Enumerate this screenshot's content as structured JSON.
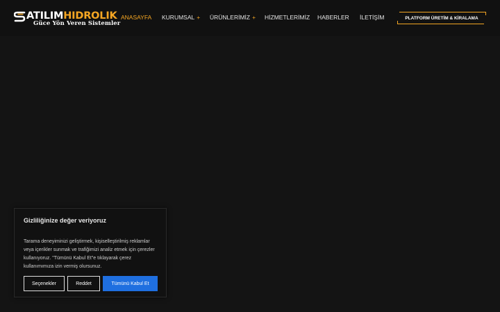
{
  "brand": {
    "name_part1": "ATILIM",
    "name_part2": "HIDROLIK",
    "tagline": "Güce Yön Veren Sistemler",
    "accent_color": "#f5a623",
    "logo_icon": "stylized-s-logo-icon"
  },
  "nav": {
    "items": [
      {
        "label": "ANASAYFA",
        "active": true,
        "has_submenu": false
      },
      {
        "label": "KURUMSAL",
        "active": false,
        "has_submenu": true
      },
      {
        "label": "ÜRÜNLERİMİZ",
        "active": false,
        "has_submenu": true
      },
      {
        "label": "HİZMETLERİMİZ",
        "active": false,
        "has_submenu": false
      },
      {
        "label": "HABERLER",
        "active": false,
        "has_submenu": false
      },
      {
        "label": "İLETİŞİM",
        "active": false,
        "has_submenu": false
      }
    ],
    "submenu_marker": "+",
    "cta_label": "PLATFORM ÜRETİM & KİRALAMA"
  },
  "cookie_banner": {
    "title": "Gizliliğinize değer veriyoruz",
    "body": "Tarama deneyiminizi geliştirmek, kişiselleştirilmiş reklamlar veya içerikler sunmak ve trafiğimizi analiz etmek için çerezler kullanıyoruz. \"Tümünü Kabul Et\"e tıklayarak çerez kullanımımıza izin vermiş olursunuz.",
    "options_label": "Seçenekler",
    "reject_label": "Reddet",
    "accept_label": "Tümünü Kabul Et",
    "accept_color": "#1f6fe0"
  }
}
